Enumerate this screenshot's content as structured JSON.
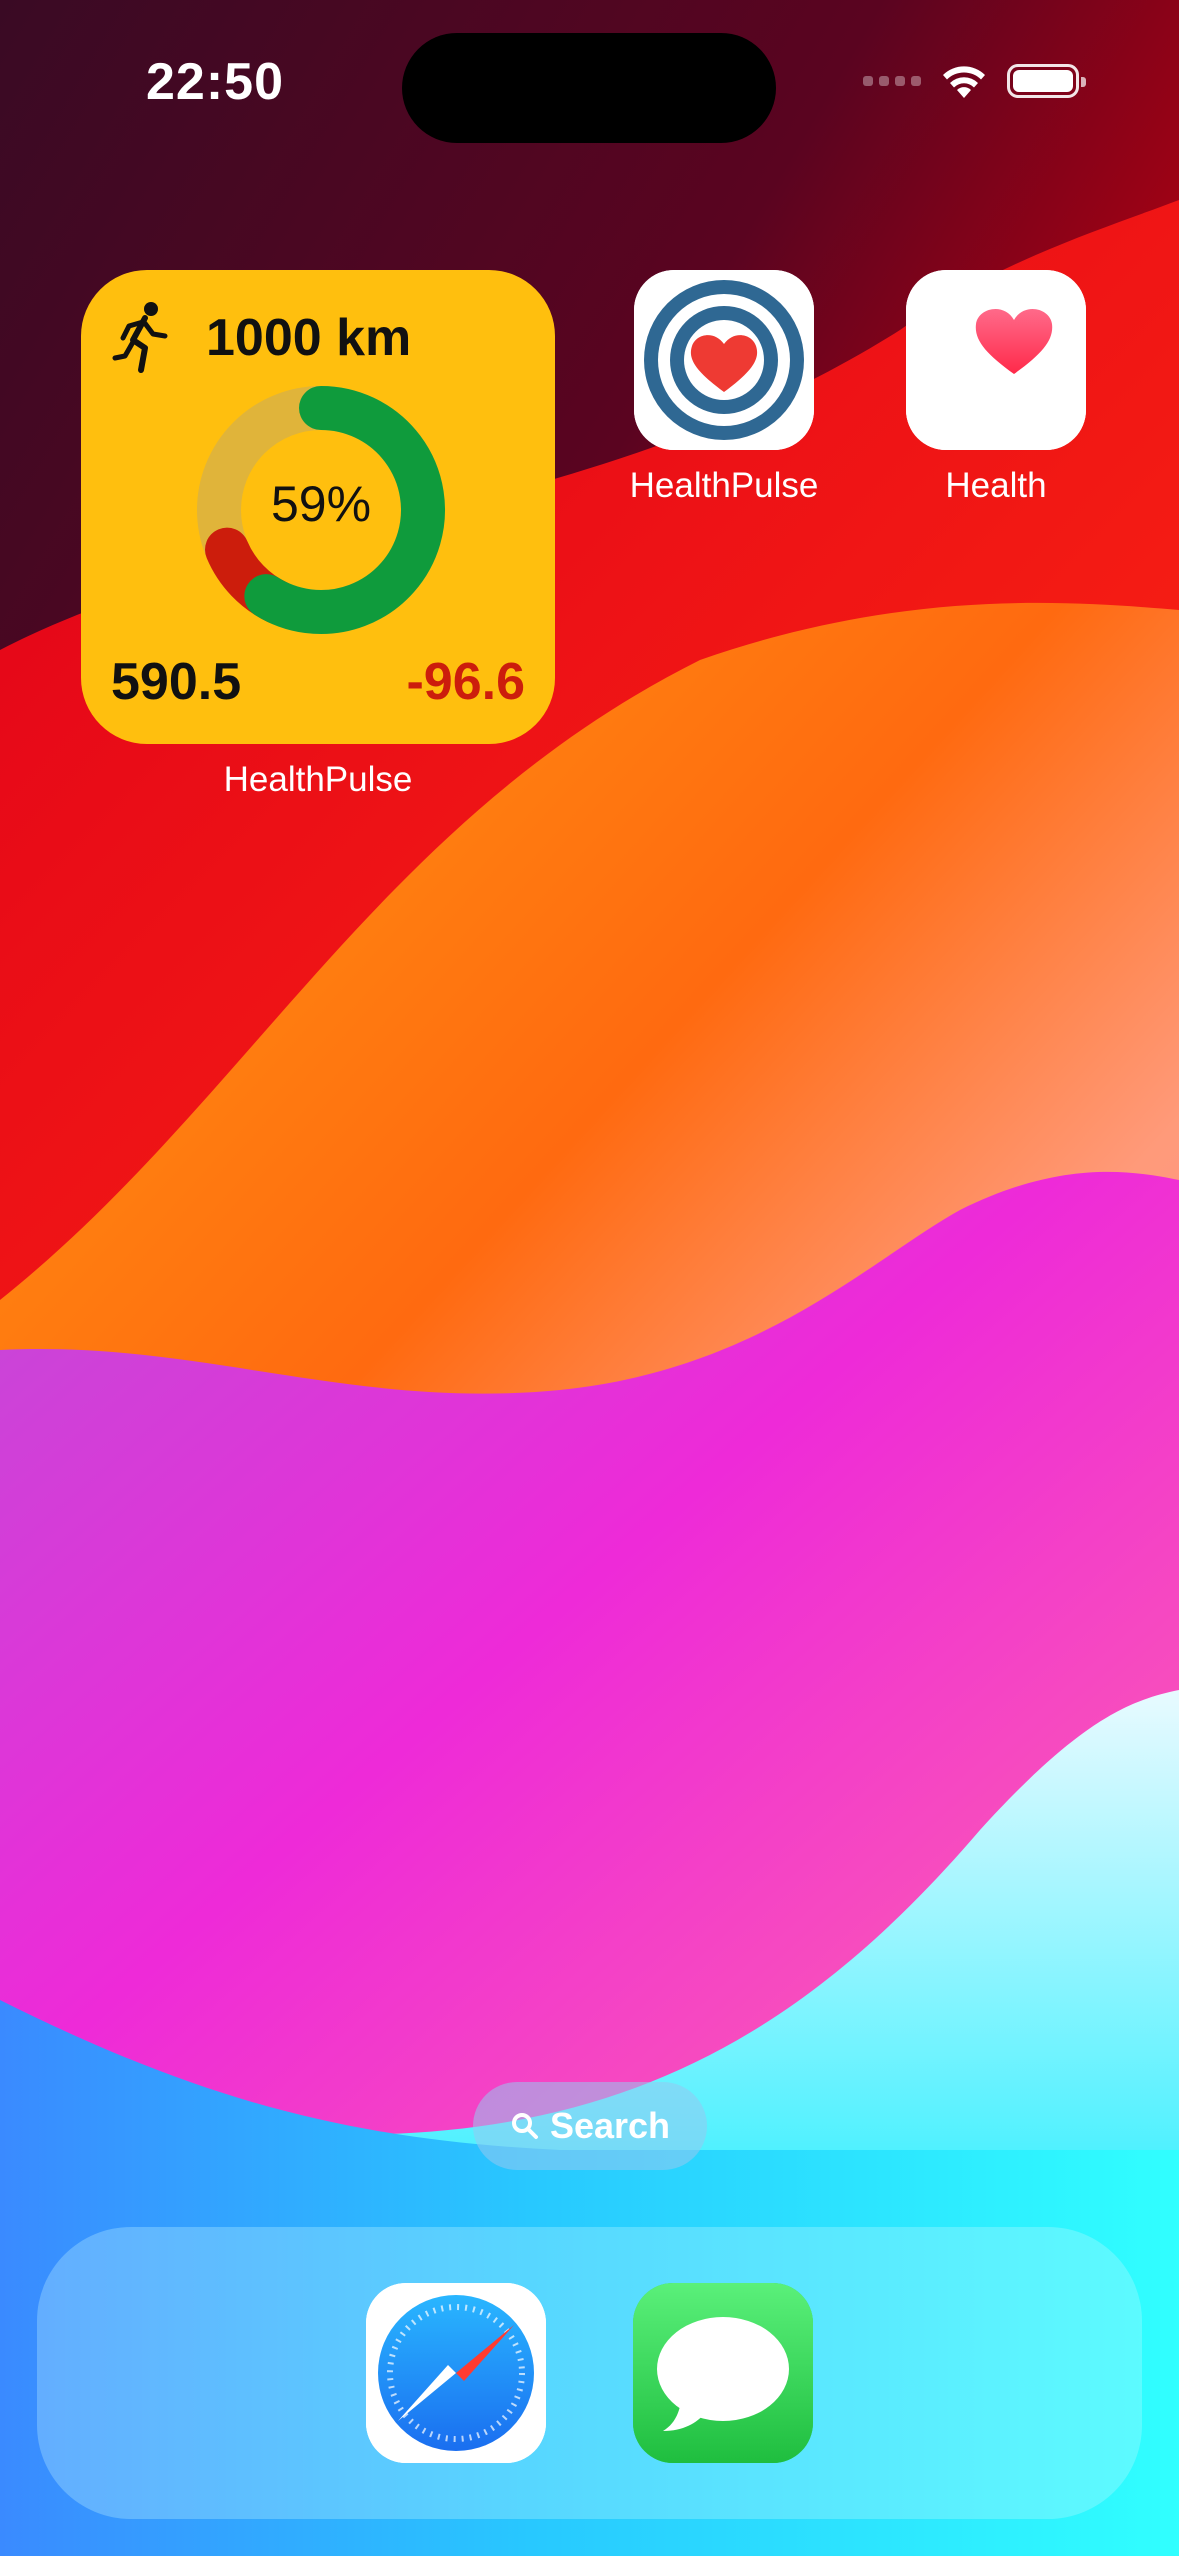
{
  "status_bar": {
    "time": "22:50"
  },
  "widget": {
    "distance": "1000 km",
    "percent": "59%",
    "progress": 0.59,
    "done_value": "590.5",
    "delta_value": "-96.6",
    "label": "HealthPulse",
    "icon": "running-person-icon",
    "colors": {
      "background": "#ffbf0e",
      "ring_done": "#0f9b3c",
      "ring_delta": "#cc1d0c",
      "ring_track": "#e0b43a",
      "delta_text": "#cc1d0c"
    }
  },
  "apps": [
    {
      "name": "HealthPulse",
      "icon": "healthpulse-target-heart-icon"
    },
    {
      "name": "Health",
      "icon": "health-heart-icon"
    }
  ],
  "search": {
    "label": "Search",
    "icon": "magnifier-icon"
  },
  "dock": {
    "apps": [
      {
        "name": "Safari",
        "icon": "safari-compass-icon"
      },
      {
        "name": "Messages",
        "icon": "messages-bubble-icon"
      }
    ]
  }
}
